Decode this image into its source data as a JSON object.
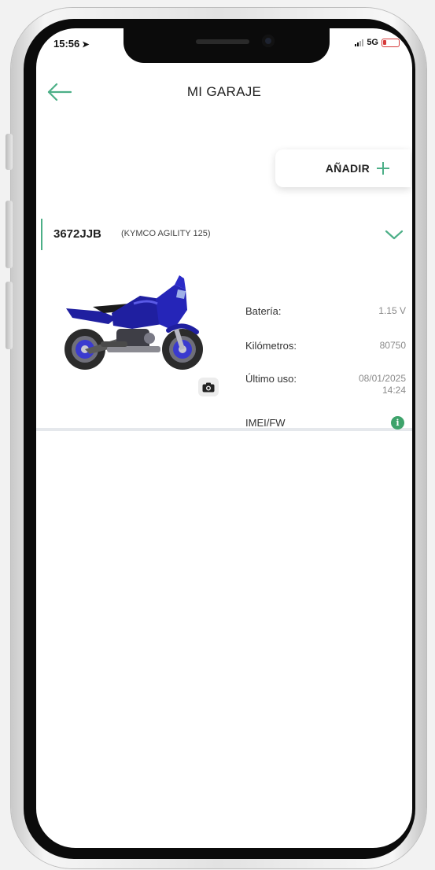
{
  "status_bar": {
    "time": "15:56",
    "network": "5G"
  },
  "header": {
    "title": "MI GARAJE"
  },
  "add_button": {
    "label": "AÑADIR"
  },
  "vehicle": {
    "plate": "3672JJB",
    "model": "(KYMCO AGILITY 125)",
    "details": [
      {
        "label": "Batería:",
        "value": "1.15 V"
      },
      {
        "label": "Kilómetros:",
        "value": "80750"
      },
      {
        "label": "Último uso:",
        "value": "08/01/2025",
        "value_line2": "14:24"
      },
      {
        "label": "IMEI/FW",
        "icon": "info-icon"
      }
    ]
  },
  "icons": {
    "back": "arrow-left-icon",
    "add": "plus-icon",
    "expand": "chevron-down-icon",
    "photo": "camera-icon",
    "info": "info-icon"
  },
  "colors": {
    "accent": "#4caf87",
    "info_green": "#3ea36b",
    "battery_low": "#d63a3a",
    "motorcycle_blue": "#1f1fa0"
  }
}
